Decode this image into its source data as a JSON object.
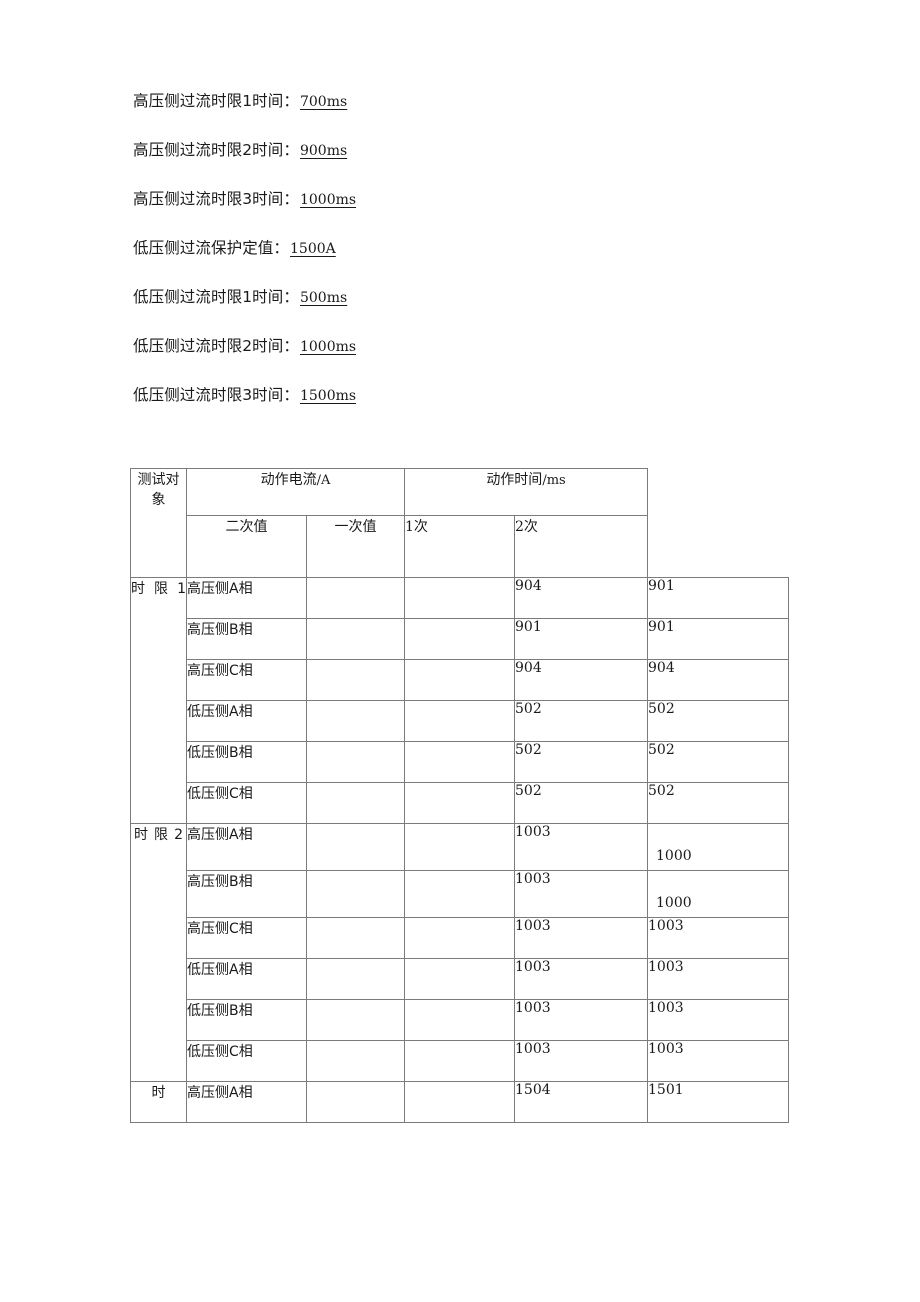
{
  "settings": {
    "lines": [
      {
        "label": "高压侧过流时限1时间：",
        "value": "700ms"
      },
      {
        "label": "高压侧过流时限2时间：",
        "value": "900ms"
      },
      {
        "label": "高压侧过流时限3时间：",
        "value": "1000ms"
      },
      {
        "label": "低压侧过流保护定值：",
        "value": "1500A"
      },
      {
        "label": "低压侧过流时限1时间：",
        "value": "500ms"
      },
      {
        "label": "低压侧过流时限2时间：",
        "value": "1000ms"
      },
      {
        "label": "低压侧过流时限3时间：",
        "value": "1500ms"
      }
    ]
  },
  "table": {
    "headers": {
      "object": "测试对象",
      "current_group": "动作电流/A",
      "current_unit_main": "动作电流",
      "current_unit_suffix": "/A",
      "time_group": "动作时间/ms",
      "time_unit_main": "动作时间",
      "time_unit_suffix": "/ms",
      "secondary": "二次值",
      "primary": "一次值",
      "trial1": "1次",
      "trial2": "2次"
    },
    "groups": [
      {
        "label": "时 限 1",
        "label_mode": "two-line",
        "rows": [
          {
            "object": "高压侧A相",
            "secondary": "",
            "primary": "",
            "trial1": "904",
            "trial2": "901",
            "trial2_low": false
          },
          {
            "object": "高压侧B相",
            "secondary": "",
            "primary": "",
            "trial1": "901",
            "trial2": "901",
            "trial2_low": false
          },
          {
            "object": "高压侧C相",
            "secondary": "",
            "primary": "",
            "trial1": "904",
            "trial2": "904",
            "trial2_low": false
          },
          {
            "object": "低压侧A相",
            "secondary": "",
            "primary": "",
            "trial1": "502",
            "trial2": "502",
            "trial2_low": false
          },
          {
            "object": "低压侧B相",
            "secondary": "",
            "primary": "",
            "trial1": "502",
            "trial2": "502",
            "trial2_low": false
          },
          {
            "object": "低压侧C相",
            "secondary": "",
            "primary": "",
            "trial1": "502",
            "trial2": "502",
            "trial2_low": false
          }
        ]
      },
      {
        "label": "时 限 2",
        "label_mode": "one-line",
        "rows": [
          {
            "object": "高压侧A相",
            "secondary": "",
            "primary": "",
            "trial1": "1003",
            "trial2": "1000",
            "trial2_low": true
          },
          {
            "object": "高压侧B相",
            "secondary": "",
            "primary": "",
            "trial1": "1003",
            "trial2": "1000",
            "trial2_low": true
          },
          {
            "object": "高压侧C相",
            "secondary": "",
            "primary": "",
            "trial1": "1003",
            "trial2": "1003",
            "trial2_low": false
          },
          {
            "object": "低压侧A相",
            "secondary": "",
            "primary": "",
            "trial1": "1003",
            "trial2": "1003",
            "trial2_low": false
          },
          {
            "object": "低压侧B相",
            "secondary": "",
            "primary": "",
            "trial1": "1003",
            "trial2": "1003",
            "trial2_low": false
          },
          {
            "object": "低压侧C相",
            "secondary": "",
            "primary": "",
            "trial1": "1003",
            "trial2": "1003",
            "trial2_low": false
          }
        ]
      },
      {
        "label": "时",
        "label_mode": "single",
        "rows": [
          {
            "object": "高压侧A相",
            "secondary": "",
            "primary": "",
            "trial1": "1504",
            "trial2": "1501",
            "trial2_low": false
          }
        ]
      }
    ]
  }
}
